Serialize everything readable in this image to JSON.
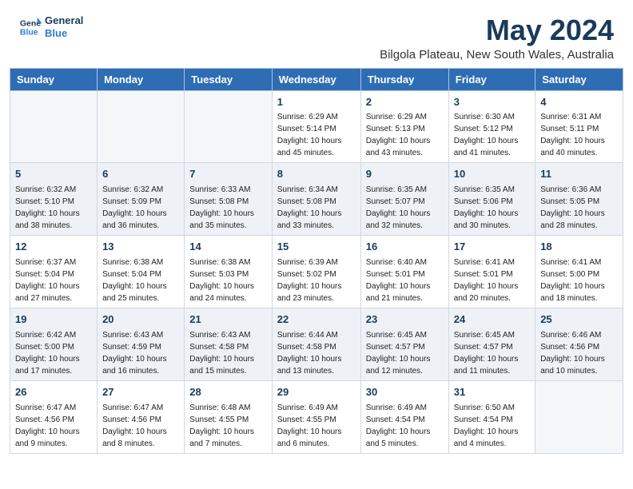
{
  "logo": {
    "line1": "General",
    "line2": "Blue"
  },
  "title": "May 2024",
  "subtitle": "Bilgola Plateau, New South Wales, Australia",
  "days_of_week": [
    "Sunday",
    "Monday",
    "Tuesday",
    "Wednesday",
    "Thursday",
    "Friday",
    "Saturday"
  ],
  "weeks": [
    [
      {
        "day": "",
        "info": ""
      },
      {
        "day": "",
        "info": ""
      },
      {
        "day": "",
        "info": ""
      },
      {
        "day": "1",
        "info": "Sunrise: 6:29 AM\nSunset: 5:14 PM\nDaylight: 10 hours\nand 45 minutes."
      },
      {
        "day": "2",
        "info": "Sunrise: 6:29 AM\nSunset: 5:13 PM\nDaylight: 10 hours\nand 43 minutes."
      },
      {
        "day": "3",
        "info": "Sunrise: 6:30 AM\nSunset: 5:12 PM\nDaylight: 10 hours\nand 41 minutes."
      },
      {
        "day": "4",
        "info": "Sunrise: 6:31 AM\nSunset: 5:11 PM\nDaylight: 10 hours\nand 40 minutes."
      }
    ],
    [
      {
        "day": "5",
        "info": "Sunrise: 6:32 AM\nSunset: 5:10 PM\nDaylight: 10 hours\nand 38 minutes."
      },
      {
        "day": "6",
        "info": "Sunrise: 6:32 AM\nSunset: 5:09 PM\nDaylight: 10 hours\nand 36 minutes."
      },
      {
        "day": "7",
        "info": "Sunrise: 6:33 AM\nSunset: 5:08 PM\nDaylight: 10 hours\nand 35 minutes."
      },
      {
        "day": "8",
        "info": "Sunrise: 6:34 AM\nSunset: 5:08 PM\nDaylight: 10 hours\nand 33 minutes."
      },
      {
        "day": "9",
        "info": "Sunrise: 6:35 AM\nSunset: 5:07 PM\nDaylight: 10 hours\nand 32 minutes."
      },
      {
        "day": "10",
        "info": "Sunrise: 6:35 AM\nSunset: 5:06 PM\nDaylight: 10 hours\nand 30 minutes."
      },
      {
        "day": "11",
        "info": "Sunrise: 6:36 AM\nSunset: 5:05 PM\nDaylight: 10 hours\nand 28 minutes."
      }
    ],
    [
      {
        "day": "12",
        "info": "Sunrise: 6:37 AM\nSunset: 5:04 PM\nDaylight: 10 hours\nand 27 minutes."
      },
      {
        "day": "13",
        "info": "Sunrise: 6:38 AM\nSunset: 5:04 PM\nDaylight: 10 hours\nand 25 minutes."
      },
      {
        "day": "14",
        "info": "Sunrise: 6:38 AM\nSunset: 5:03 PM\nDaylight: 10 hours\nand 24 minutes."
      },
      {
        "day": "15",
        "info": "Sunrise: 6:39 AM\nSunset: 5:02 PM\nDaylight: 10 hours\nand 23 minutes."
      },
      {
        "day": "16",
        "info": "Sunrise: 6:40 AM\nSunset: 5:01 PM\nDaylight: 10 hours\nand 21 minutes."
      },
      {
        "day": "17",
        "info": "Sunrise: 6:41 AM\nSunset: 5:01 PM\nDaylight: 10 hours\nand 20 minutes."
      },
      {
        "day": "18",
        "info": "Sunrise: 6:41 AM\nSunset: 5:00 PM\nDaylight: 10 hours\nand 18 minutes."
      }
    ],
    [
      {
        "day": "19",
        "info": "Sunrise: 6:42 AM\nSunset: 5:00 PM\nDaylight: 10 hours\nand 17 minutes."
      },
      {
        "day": "20",
        "info": "Sunrise: 6:43 AM\nSunset: 4:59 PM\nDaylight: 10 hours\nand 16 minutes."
      },
      {
        "day": "21",
        "info": "Sunrise: 6:43 AM\nSunset: 4:58 PM\nDaylight: 10 hours\nand 15 minutes."
      },
      {
        "day": "22",
        "info": "Sunrise: 6:44 AM\nSunset: 4:58 PM\nDaylight: 10 hours\nand 13 minutes."
      },
      {
        "day": "23",
        "info": "Sunrise: 6:45 AM\nSunset: 4:57 PM\nDaylight: 10 hours\nand 12 minutes."
      },
      {
        "day": "24",
        "info": "Sunrise: 6:45 AM\nSunset: 4:57 PM\nDaylight: 10 hours\nand 11 minutes."
      },
      {
        "day": "25",
        "info": "Sunrise: 6:46 AM\nSunset: 4:56 PM\nDaylight: 10 hours\nand 10 minutes."
      }
    ],
    [
      {
        "day": "26",
        "info": "Sunrise: 6:47 AM\nSunset: 4:56 PM\nDaylight: 10 hours\nand 9 minutes."
      },
      {
        "day": "27",
        "info": "Sunrise: 6:47 AM\nSunset: 4:56 PM\nDaylight: 10 hours\nand 8 minutes."
      },
      {
        "day": "28",
        "info": "Sunrise: 6:48 AM\nSunset: 4:55 PM\nDaylight: 10 hours\nand 7 minutes."
      },
      {
        "day": "29",
        "info": "Sunrise: 6:49 AM\nSunset: 4:55 PM\nDaylight: 10 hours\nand 6 minutes."
      },
      {
        "day": "30",
        "info": "Sunrise: 6:49 AM\nSunset: 4:54 PM\nDaylight: 10 hours\nand 5 minutes."
      },
      {
        "day": "31",
        "info": "Sunrise: 6:50 AM\nSunset: 4:54 PM\nDaylight: 10 hours\nand 4 minutes."
      },
      {
        "day": "",
        "info": ""
      }
    ]
  ]
}
